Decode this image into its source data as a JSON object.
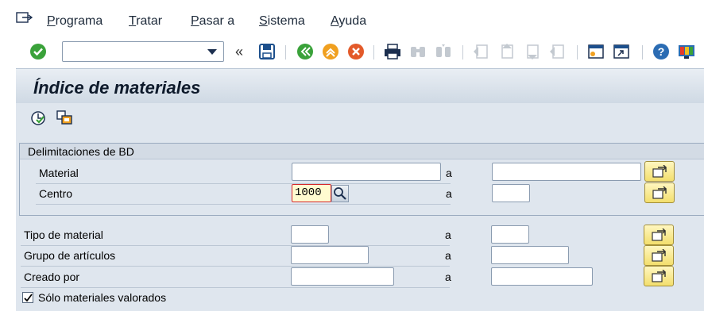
{
  "menubar": {
    "items": [
      "Programa",
      "Tratar",
      "Pasar a",
      "Sistema",
      "Ayuda"
    ],
    "mnemonics": [
      "P",
      "T",
      "P",
      "S",
      "A"
    ]
  },
  "toolbar": {
    "command_field": {
      "value": ""
    },
    "icons": [
      "enter-check-icon",
      "save-icon",
      "back-icon",
      "exit-icon",
      "cancel-icon",
      "print-icon",
      "find-icon",
      "find-next-icon",
      "first-page-icon",
      "previous-page-icon",
      "next-page-icon",
      "last-page-icon",
      "create-session-icon",
      "shortcut-icon",
      "help-icon",
      "layout-icon"
    ]
  },
  "title": "Índice de materiales",
  "app_toolbar": {
    "icons": [
      "execute-icon",
      "get-variant-icon"
    ]
  },
  "group": {
    "title": "Delimitaciones de BD",
    "rows": [
      {
        "label": "Material",
        "from": "",
        "to_label": "a",
        "to": ""
      },
      {
        "label": "Centro",
        "from": "1000",
        "to_label": "a",
        "to": ""
      }
    ]
  },
  "selection_rows": [
    {
      "label": "Tipo de material",
      "from": "",
      "to_label": "a",
      "to": ""
    },
    {
      "label": "Grupo de artículos",
      "from": "",
      "to_label": "a",
      "to": ""
    },
    {
      "label": "Creado por",
      "from": "",
      "to_label": "a",
      "to": ""
    }
  ],
  "checkbox": {
    "label": "Sólo materiales valorados",
    "checked": true
  },
  "colors": {
    "accent_blue": "#1c2f4f",
    "title_bg": "#cfd9e4",
    "body_bg": "#dfe6ee",
    "focus_border": "#d4262c",
    "select_btn": "#f3df6d"
  }
}
